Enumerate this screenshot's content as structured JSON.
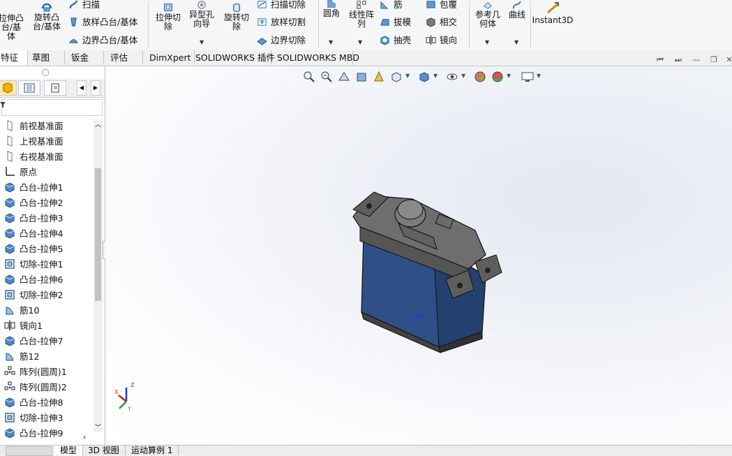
{
  "ribbon": {
    "extrude_boss": "拉伸凸\n台/基体",
    "revolve_boss": "旋转凸\n台/基体",
    "sweep": "扫描",
    "loft_boss": "放样凸台/基体",
    "boundary_boss": "边界凸台/基体",
    "extrude_cut": "拉伸切\n除",
    "hole_wizard": "异型孔\n向导",
    "revolve_cut": "旋转切\n除",
    "swept_cut": "扫描切除",
    "lofted_cut": "放样切割",
    "boundary_cut": "边界切除",
    "fillet": "圆角",
    "linear_pattern": "线性阵\n列",
    "rib": "筋",
    "draft": "拔模",
    "shell": "抽壳",
    "wrap": "包覆",
    "intersect": "相交",
    "mirror": "镜向",
    "ref_geometry": "参考几\n何体",
    "curves": "曲线",
    "instant3d": "Instant3D"
  },
  "tabs": [
    {
      "label": "特征",
      "active": true
    },
    {
      "label": "草图",
      "active": false
    },
    {
      "label": "钣金",
      "active": false
    },
    {
      "label": "评估",
      "active": false
    },
    {
      "label": "DimXpert",
      "active": false
    },
    {
      "label": "SOLIDWORKS 插件",
      "active": false
    },
    {
      "label": "SOLIDWORKS MBD",
      "active": false
    }
  ],
  "tree": [
    {
      "label": "前视基准面",
      "icon": "plane-icon"
    },
    {
      "label": "上视基准面",
      "icon": "plane-icon"
    },
    {
      "label": "右视基准面",
      "icon": "plane-icon"
    },
    {
      "label": "原点",
      "icon": "origin-icon"
    },
    {
      "label": "凸台-拉伸1",
      "icon": "boss-extrude-icon"
    },
    {
      "label": "凸台-拉伸2",
      "icon": "boss-extrude-icon"
    },
    {
      "label": "凸台-拉伸3",
      "icon": "boss-extrude-icon"
    },
    {
      "label": "凸台-拉伸4",
      "icon": "boss-extrude-icon"
    },
    {
      "label": "凸台-拉伸5",
      "icon": "boss-extrude-icon"
    },
    {
      "label": "切除-拉伸1",
      "icon": "cut-extrude-icon"
    },
    {
      "label": "凸台-拉伸6",
      "icon": "boss-extrude-icon"
    },
    {
      "label": "切除-拉伸2",
      "icon": "cut-extrude-icon"
    },
    {
      "label": "筋10",
      "icon": "rib-icon"
    },
    {
      "label": "镜向1",
      "icon": "mirror-icon"
    },
    {
      "label": "凸台-拉伸7",
      "icon": "boss-extrude-icon"
    },
    {
      "label": "筋12",
      "icon": "rib-icon"
    },
    {
      "label": "阵列(圆周)1",
      "icon": "circular-pattern-icon"
    },
    {
      "label": "阵列(圆周)2",
      "icon": "circular-pattern-icon"
    },
    {
      "label": "凸台-拉伸8",
      "icon": "boss-extrude-icon"
    },
    {
      "label": "切除-拉伸3",
      "icon": "cut-extrude-icon"
    },
    {
      "label": "凸台-拉伸9",
      "icon": "boss-extrude-icon"
    }
  ],
  "bottom_tabs": [
    {
      "label": "模型",
      "active": true
    },
    {
      "label": "3D 视图",
      "active": false
    },
    {
      "label": "运动算例 1",
      "active": false
    }
  ],
  "triad": {
    "x": "X",
    "y": "Y",
    "z": "Z"
  },
  "colors": {
    "accent": "#2b5797",
    "model_body": "#2f4f86",
    "model_top": "#6e6e6e"
  }
}
